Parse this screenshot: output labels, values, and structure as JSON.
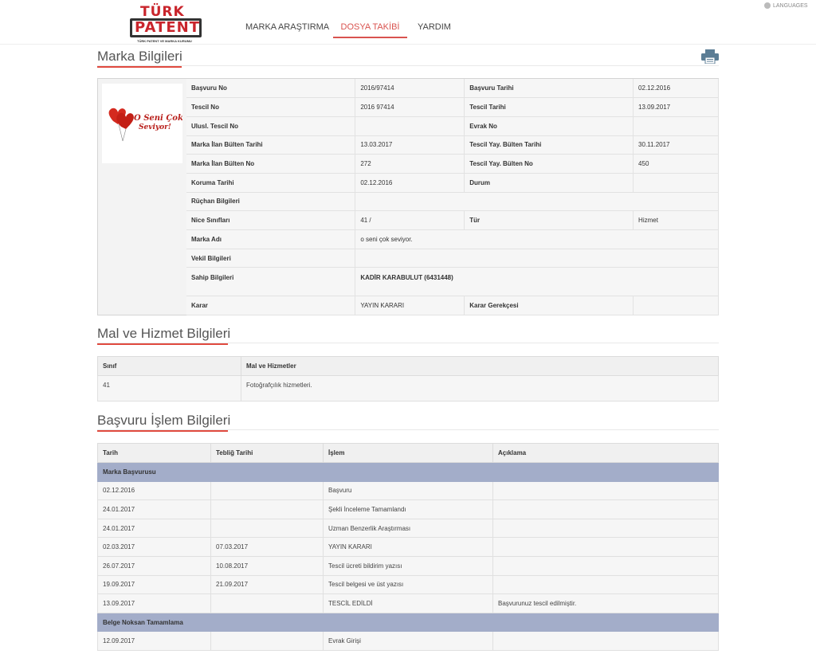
{
  "header": {
    "logo_top": "TÜRK",
    "logo_main": "PATENT",
    "logo_sub": "TÜRK PATENT VE MARKA KURUMU",
    "nav": [
      "MARKA ARAŞTIRMA",
      "DOSYA TAKİBİ",
      "YARDIM"
    ],
    "languages": "LANGUAGES"
  },
  "marka": {
    "title": "Marka Bilgileri",
    "logo_text_1": "O Seni Çok",
    "logo_text_2": "Seviyor!",
    "rows": [
      [
        "Başvuru No",
        "2016/97414",
        "Başvuru Tarihi",
        "02.12.2016"
      ],
      [
        "Tescil No",
        "2016 97414",
        "Tescil Tarihi",
        "13.09.2017"
      ],
      [
        "Ulusl. Tescil No",
        "",
        "Evrak No",
        ""
      ],
      [
        "Marka İlan Bülten Tarihi",
        "13.03.2017",
        "Tescil Yay. Bülten Tarihi",
        "30.11.2017"
      ],
      [
        "Marka İlan Bülten No",
        "272",
        "Tescil Yay. Bülten No",
        "450"
      ],
      [
        "Koruma Tarihi",
        "02.12.2016",
        "Durum",
        ""
      ],
      [
        "Rüçhan Bilgileri",
        ""
      ],
      [
        "Nice Sınıfları",
        "41 /",
        "Tür",
        "Hizmet"
      ],
      [
        "Marka Adı",
        "o seni çok seviyor."
      ],
      [
        "Vekil Bilgileri",
        ""
      ],
      [
        "Sahip Bilgileri",
        "KADİR KARABULUT (6431448)"
      ],
      [
        "Karar",
        "YAYIN KARARI",
        "Karar Gerekçesi",
        ""
      ]
    ]
  },
  "mal": {
    "title": "Mal ve Hizmet Bilgileri",
    "headers": [
      "Sınıf",
      "Mal ve Hizmetler"
    ],
    "rows": [
      [
        "41",
        "Fotoğrafçılık hizmetleri."
      ]
    ]
  },
  "islem": {
    "title": "Başvuru İşlem Bilgileri",
    "headers": [
      "Tarih",
      "Tebliğ Tarihi",
      "İşlem",
      "Açıklama"
    ],
    "groups": [
      {
        "name": "Marka Başvurusu",
        "rows": [
          [
            "02.12.2016",
            "",
            "Başvuru",
            ""
          ],
          [
            "24.01.2017",
            "",
            "Şekli İnceleme Tamamlandı",
            ""
          ],
          [
            "24.01.2017",
            "",
            "Uzman Benzerlik Araştırması",
            ""
          ],
          [
            "02.03.2017",
            "07.03.2017",
            "YAYIN KARARI",
            ""
          ],
          [
            "26.07.2017",
            "10.08.2017",
            "Tescil ücreti bildirim yazısı",
            ""
          ],
          [
            "19.09.2017",
            "21.09.2017",
            "Tescil belgesi ve üst yazısı",
            ""
          ],
          [
            "13.09.2017",
            "",
            "TESCİL EDİLDİ",
            "Başvurunuz tescil edilmiştir."
          ]
        ]
      },
      {
        "name": "Belge Noksan Tamamlama",
        "rows": [
          [
            "12.09.2017",
            "",
            "Evrak Girişi",
            ""
          ]
        ]
      }
    ]
  }
}
